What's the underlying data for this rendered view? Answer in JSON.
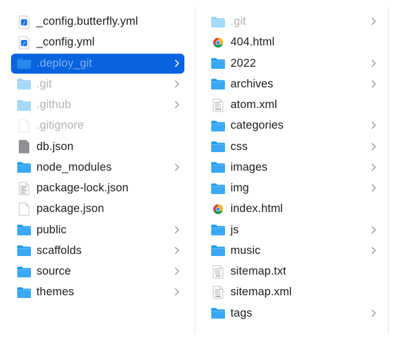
{
  "left_column": [
    {
      "name": "_config.butterfly.yml",
      "type": "yml"
    },
    {
      "name": "_config.yml",
      "type": "yml"
    },
    {
      "name": ".deploy_git",
      "type": "folder",
      "selected": true,
      "hidden": true
    },
    {
      "name": ".git",
      "type": "folder",
      "hidden": true
    },
    {
      "name": ".github",
      "type": "folder",
      "hidden": true
    },
    {
      "name": ".gitignore",
      "type": "blank",
      "hidden": true
    },
    {
      "name": "db.json",
      "type": "json-gray"
    },
    {
      "name": "node_modules",
      "type": "folder"
    },
    {
      "name": "package-lock.json",
      "type": "doc"
    },
    {
      "name": "package.json",
      "type": "blank"
    },
    {
      "name": "public",
      "type": "folder"
    },
    {
      "name": "scaffolds",
      "type": "folder"
    },
    {
      "name": "source",
      "type": "folder"
    },
    {
      "name": "themes",
      "type": "folder"
    }
  ],
  "right_column": [
    {
      "name": ".git",
      "type": "folder",
      "hidden": true
    },
    {
      "name": "404.html",
      "type": "chrome"
    },
    {
      "name": "2022",
      "type": "folder"
    },
    {
      "name": "archives",
      "type": "folder"
    },
    {
      "name": "atom.xml",
      "type": "xml-doc",
      "badge": "SVG"
    },
    {
      "name": "categories",
      "type": "folder"
    },
    {
      "name": "css",
      "type": "folder"
    },
    {
      "name": "images",
      "type": "folder"
    },
    {
      "name": "img",
      "type": "folder"
    },
    {
      "name": "index.html",
      "type": "chrome"
    },
    {
      "name": "js",
      "type": "folder"
    },
    {
      "name": "music",
      "type": "folder"
    },
    {
      "name": "sitemap.txt",
      "type": "txt-doc",
      "badge": "TXT"
    },
    {
      "name": "sitemap.xml",
      "type": "xml-doc",
      "badge": "XML"
    },
    {
      "name": "tags",
      "type": "folder"
    }
  ],
  "colors": {
    "selection": "#0a63de",
    "folder": "#1d9bf0",
    "text": "#1d1d1f",
    "dim_text": "#b2b2b7"
  }
}
